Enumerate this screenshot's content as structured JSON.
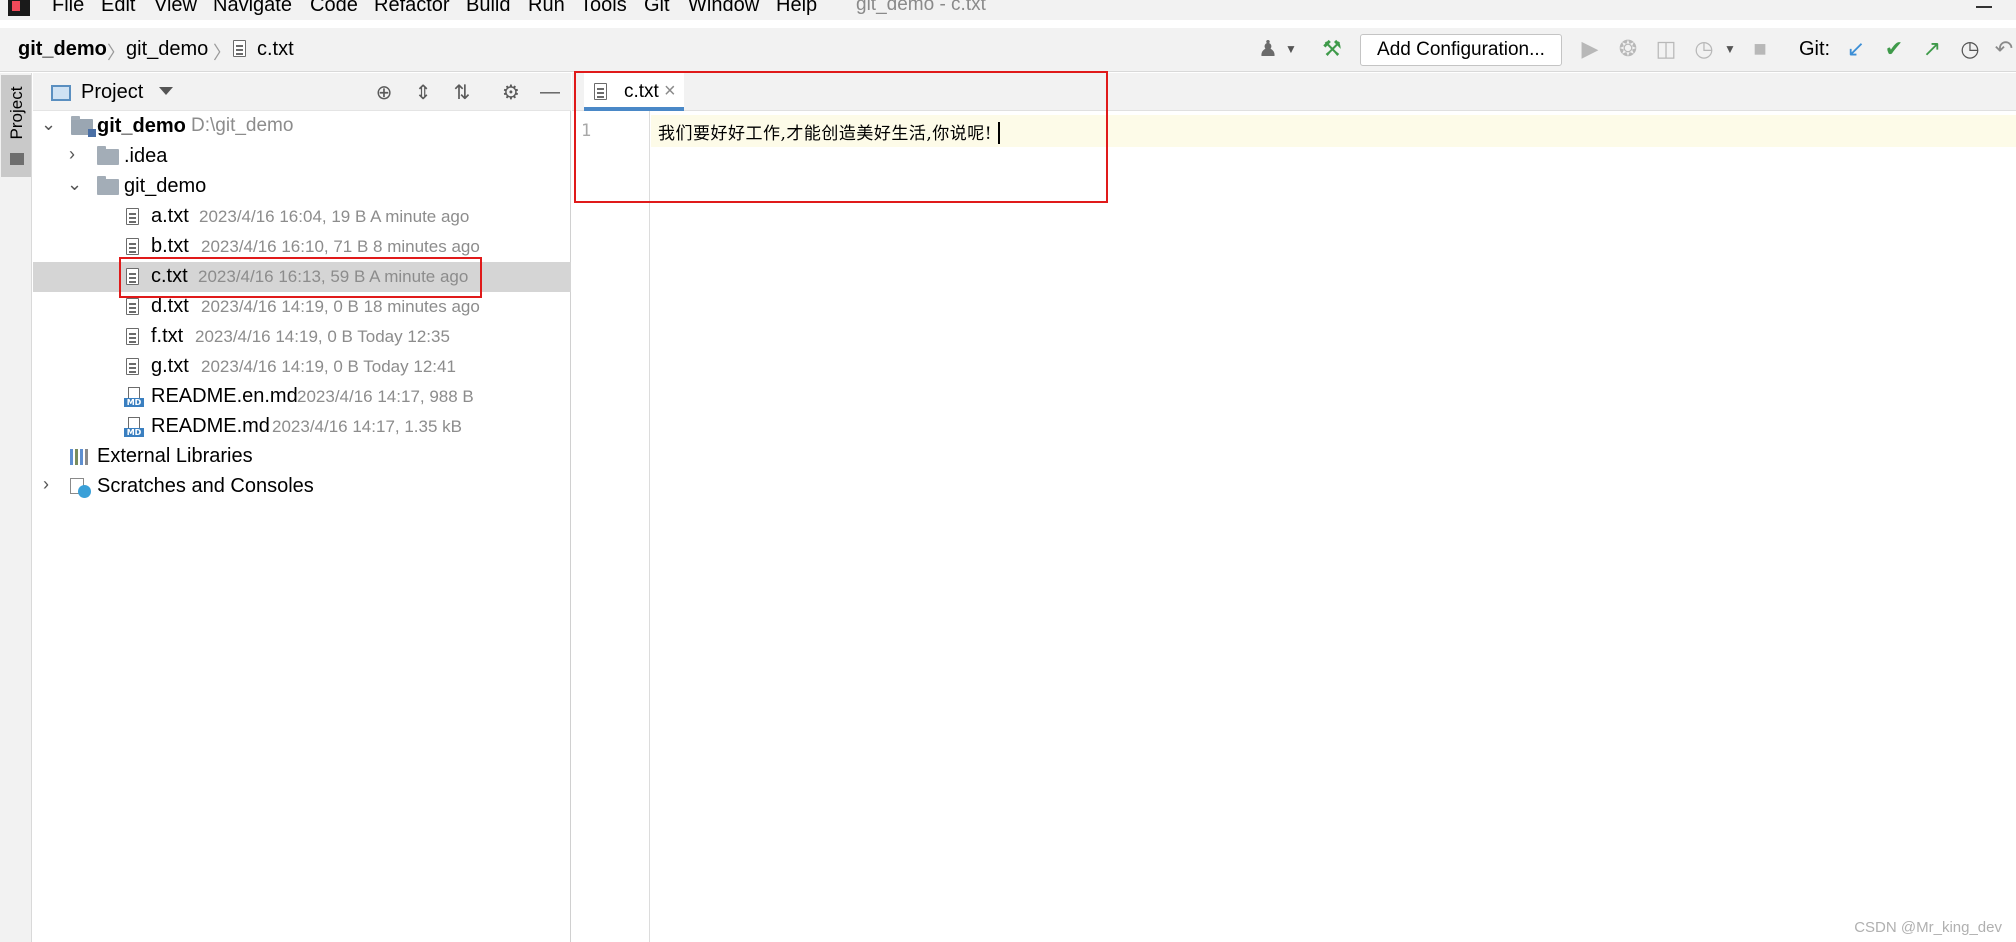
{
  "menubar": {
    "items": [
      "File",
      "Edit",
      "View",
      "Navigate",
      "Code",
      "Refactor",
      "Build",
      "Run",
      "Tools",
      "Git",
      "Window",
      "Help"
    ],
    "window_title": "git_demo - c.txt"
  },
  "navbar": {
    "breadcrumbs": [
      "git_demo",
      "git_demo",
      "c.txt"
    ],
    "add_configuration": "Add Configuration...",
    "git_label": "Git:",
    "icons": [
      "user-icon",
      "build-hammer-icon",
      "run-icon",
      "debug-icon",
      "coverage-icon",
      "profile-icon",
      "stop-icon",
      "git-update-icon",
      "git-commit-icon",
      "git-push-icon",
      "git-history-icon",
      "git-rollback-icon"
    ]
  },
  "tool_stripe": {
    "project_tab": "Project"
  },
  "project_panel": {
    "title": "Project",
    "root": {
      "name": "git_demo",
      "path": "D:\\git_demo"
    },
    "idea_folder": ".idea",
    "subfolder": "git_demo",
    "files": [
      {
        "name": "a.txt",
        "meta": "2023/4/16 16:04, 19 B A minute ago",
        "type": "txt"
      },
      {
        "name": "b.txt",
        "meta": "2023/4/16 16:10, 71 B 8 minutes ago",
        "type": "txt"
      },
      {
        "name": "c.txt",
        "meta": "2023/4/16 16:13, 59 B A minute ago",
        "type": "txt",
        "selected": true
      },
      {
        "name": "d.txt",
        "meta": "2023/4/16 14:19, 0 B 18 minutes ago",
        "type": "txt"
      },
      {
        "name": "f.txt",
        "meta": "2023/4/16 14:19, 0 B Today 12:35",
        "type": "txt"
      },
      {
        "name": "g.txt",
        "meta": "2023/4/16 14:19, 0 B Today 12:41",
        "type": "txt"
      },
      {
        "name": "README.en.md",
        "meta": "2023/4/16 14:17, 988 B",
        "type": "md"
      },
      {
        "name": "README.md",
        "meta": "2023/4/16 14:17, 1.35 kB",
        "type": "md"
      }
    ],
    "external_libraries": "External Libraries",
    "scratches": "Scratches and Consoles",
    "md_badge": "MD"
  },
  "editor": {
    "tab_label": "c.txt",
    "line_number": "1",
    "code": "我们要好好工作,才能创造美好生活,你说呢!"
  },
  "watermark": "CSDN @Mr_king_dev",
  "colors": {
    "selection": "#d5d5d5",
    "highlight_box": "#e01a1a",
    "tab_underline": "#4a88c7",
    "current_line": "#fdfbe8"
  }
}
